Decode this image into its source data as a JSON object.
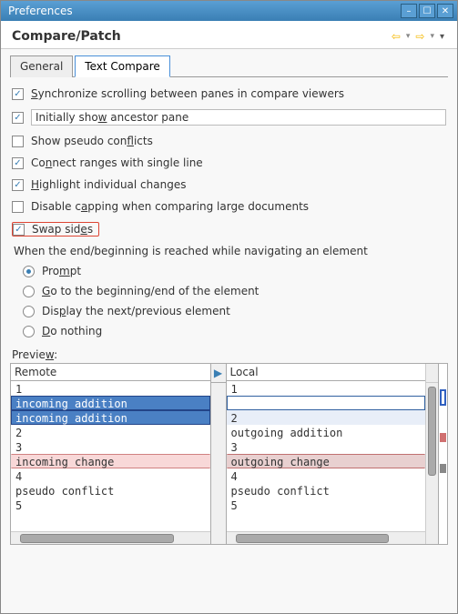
{
  "window": {
    "title": "Preferences"
  },
  "header": {
    "title": "Compare/Patch"
  },
  "tabs": [
    {
      "label": "General",
      "active": false
    },
    {
      "label": "Text Compare",
      "active": true
    }
  ],
  "options": {
    "sync": {
      "label_pre": "",
      "mn": "S",
      "label_post": "ynchronize scrolling between panes in compare viewers",
      "checked": true
    },
    "ancestor": {
      "label_pre": "Initially sho",
      "mn": "w",
      "label_post": " ancestor pane",
      "checked": true
    },
    "pseudo": {
      "label_pre": "Show pseudo con",
      "mn": "f",
      "label_post": "licts",
      "checked": false
    },
    "connect": {
      "label_pre": "Co",
      "mn": "n",
      "label_post": "nect ranges with single line",
      "checked": true
    },
    "highlight": {
      "label_pre": "",
      "mn": "H",
      "label_post": "ighlight individual changes",
      "checked": true
    },
    "disable": {
      "label_pre": "Disable c",
      "mn": "a",
      "label_post": "pping when comparing large documents",
      "checked": false
    },
    "swap": {
      "label_pre": "Swap sid",
      "mn": "e",
      "label_post": "s",
      "checked": true
    }
  },
  "nav_group": {
    "label": "When the end/beginning is reached while navigating an element",
    "items": {
      "prompt": {
        "label_pre": "Pro",
        "mn": "m",
        "label_post": "pt",
        "selected": true
      },
      "goto": {
        "label_pre": "",
        "mn": "G",
        "label_post": "o to the beginning/end of the element",
        "selected": false
      },
      "display": {
        "label_pre": "Dis",
        "mn": "p",
        "label_post": "lay the next/previous element",
        "selected": false
      },
      "nothing": {
        "label_pre": "",
        "mn": "D",
        "label_post": "o nothing",
        "selected": false
      }
    }
  },
  "preview": {
    "label_pre": "Previe",
    "mn": "w",
    "label_post": ":",
    "left": {
      "title": "Remote"
    },
    "right": {
      "title": "Local"
    },
    "left_lines": {
      "l0": "1",
      "l1": "incoming addition",
      "l2": "incoming addition",
      "l3": "2",
      "l4": "3",
      "l5": "incoming change",
      "l6": "4",
      "l7": "pseudo conflict",
      "l8": "5"
    },
    "right_lines": {
      "r0": "1",
      "r1": "2",
      "r2": "outgoing addition",
      "r3": "3",
      "r4": "outgoing change",
      "r5": "4",
      "r6": "pseudo conflict",
      "r7": "5"
    }
  }
}
